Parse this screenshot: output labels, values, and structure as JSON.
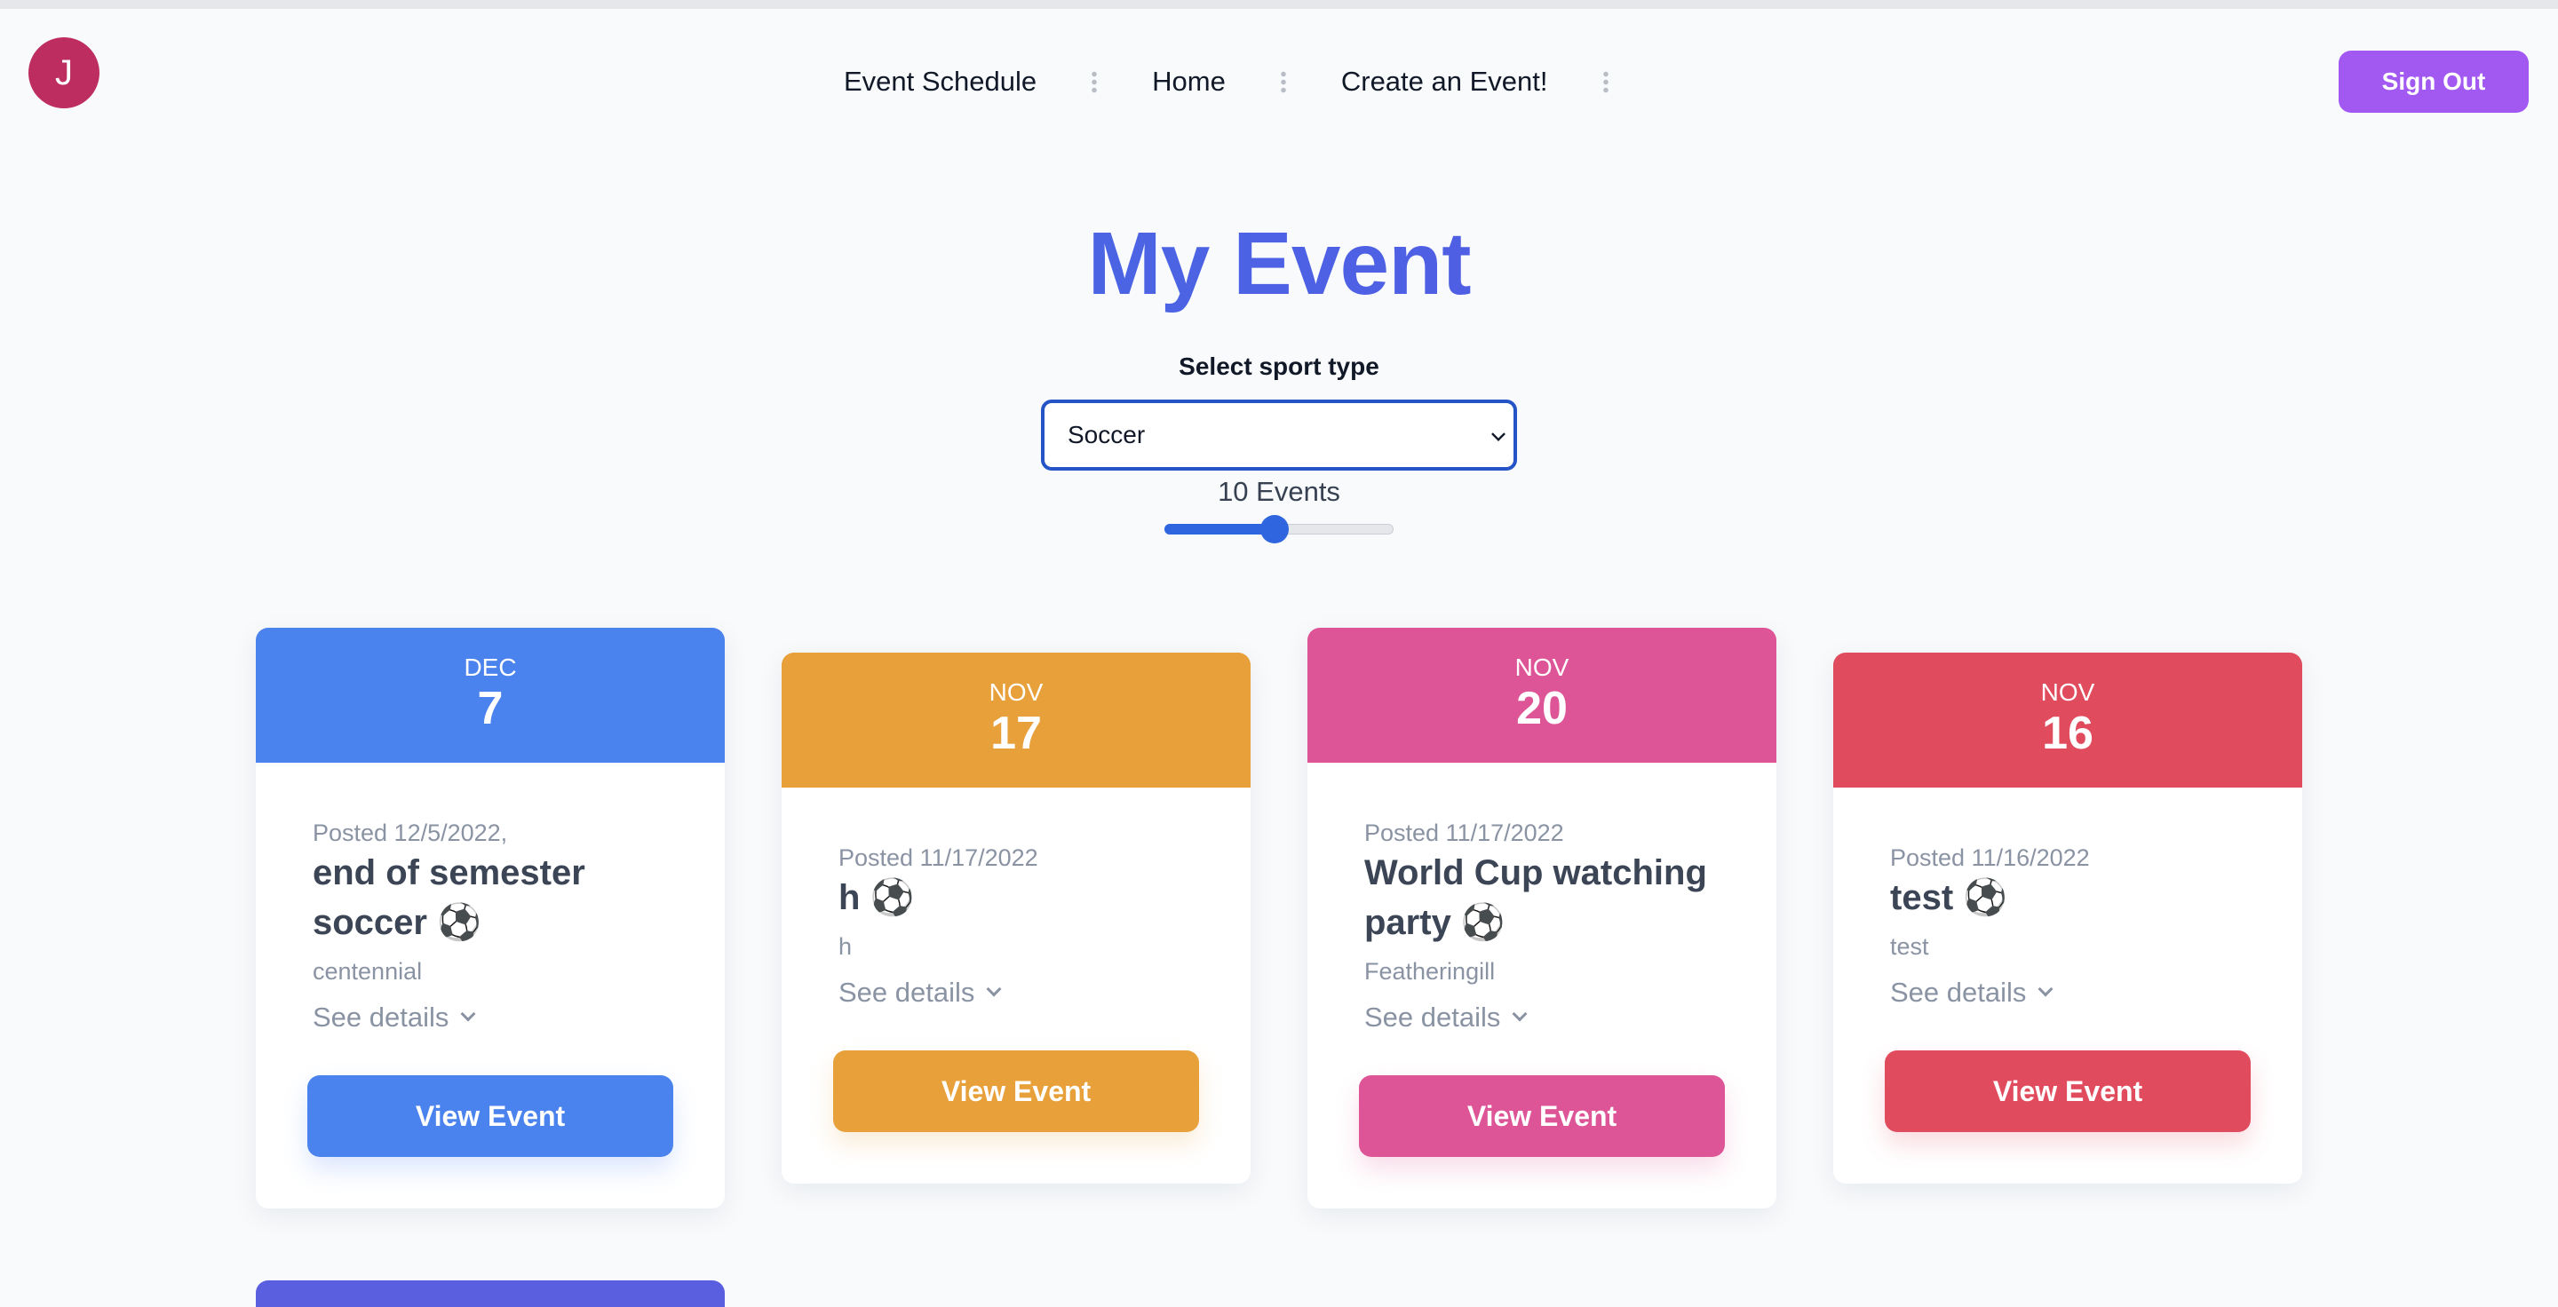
{
  "nav": {
    "avatar_initial": "J",
    "links": [
      "Event Schedule",
      "Home",
      "Create an Event!"
    ],
    "sign_out": "Sign Out"
  },
  "main": {
    "title": "My Event",
    "select_label": "Select sport type",
    "select_value": "Soccer",
    "events_count": "10 Events",
    "slider_value": 0.48
  },
  "cards": [
    {
      "month": "DEC",
      "day": "7",
      "posted": "Posted 12/5/2022,",
      "title_line1": "end of semester",
      "title_line2": "soccer ⚽",
      "location": "centennial",
      "details": "See details",
      "button": "View Event",
      "color": "#4a82ee"
    },
    {
      "month": "NOV",
      "day": "17",
      "posted": "Posted 11/17/2022",
      "title_line1": "h ⚽",
      "title_line2": "",
      "location": "h",
      "details": "See details",
      "button": "View Event",
      "color": "#e8a03a"
    },
    {
      "month": "NOV",
      "day": "20",
      "posted": "Posted 11/17/2022",
      "title_line1": "World Cup watching",
      "title_line2": "party ⚽",
      "location": "Featheringill",
      "details": "See details",
      "button": "View Event",
      "color": "#dd5597"
    },
    {
      "month": "NOV",
      "day": "16",
      "posted": "Posted 11/16/2022",
      "title_line1": "test ⚽",
      "title_line2": "",
      "location": "test",
      "details": "See details",
      "button": "View Event",
      "color": "#e14b5e"
    }
  ]
}
